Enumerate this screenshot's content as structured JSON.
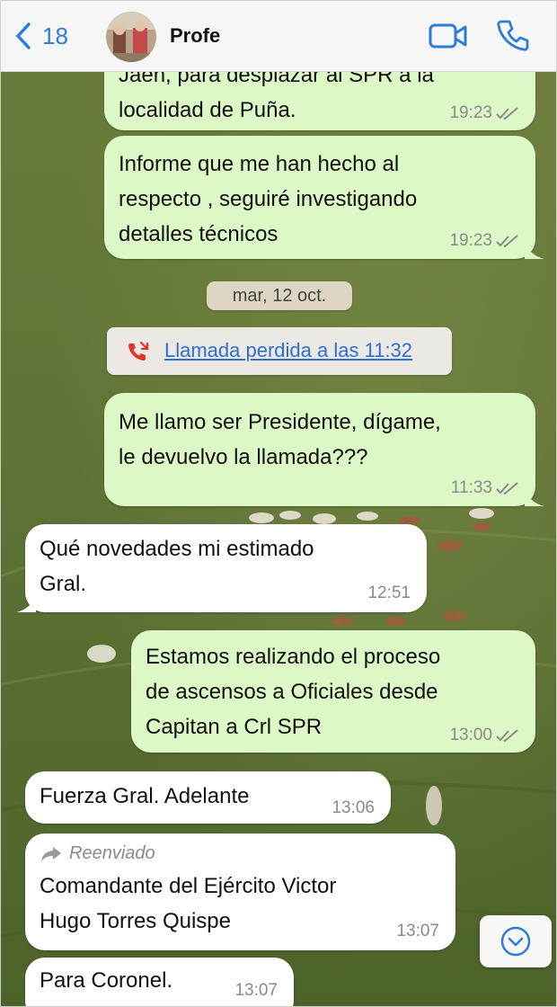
{
  "header": {
    "back_count": "18",
    "contact_name": "Profe"
  },
  "messages": [
    {
      "direction": "out",
      "lines": [
        "Jaén, para desplazar al SPR a la",
        "localidad de Puña."
      ],
      "time": "19:23"
    },
    {
      "direction": "out",
      "lines": [
        "Informe que me han hecho al",
        "respecto , seguiré investigando",
        "detalles técnicos"
      ],
      "time": "19:23"
    },
    {
      "direction": "out",
      "lines": [
        "Me llamo ser Presidente, dígame,",
        "le devuelvo la llamada???"
      ],
      "time": "11:33"
    },
    {
      "direction": "in",
      "lines": [
        "Qué novedades mi estimado",
        "Gral."
      ],
      "time": "12:51"
    },
    {
      "direction": "out",
      "lines": [
        "Estamos realizando el proceso",
        "de ascensos a Oficiales desde",
        "Capitan a Crl SPR"
      ],
      "time": "13:00"
    },
    {
      "direction": "in",
      "lines": [
        "Fuerza Gral. Adelante"
      ],
      "time": "13:06"
    },
    {
      "direction": "in",
      "forwarded_label": "Reenviado",
      "lines": [
        "Comandante del Ejército Victor",
        "Hugo Torres Quispe"
      ],
      "time": "13:07"
    },
    {
      "direction": "in",
      "lines": [
        "Para Coronel."
      ],
      "time": "13:07"
    }
  ],
  "date_separator": "mar, 12 oct.",
  "missed_call": {
    "text": "Llamada perdida a las 11:32",
    "icon": "missed-call-icon"
  },
  "icons": [
    "back-chevron-icon",
    "video-call-icon",
    "phone-icon",
    "double-check-icon",
    "forward-arrow-icon",
    "scroll-down-icon"
  ],
  "colors": {
    "accent": "#2f7bd8",
    "outgoing_bubble": "#dcf8c6",
    "incoming_bubble": "#ffffff",
    "missed_call_red": "#e0332e",
    "wallpaper_green": "#5a6f33"
  }
}
